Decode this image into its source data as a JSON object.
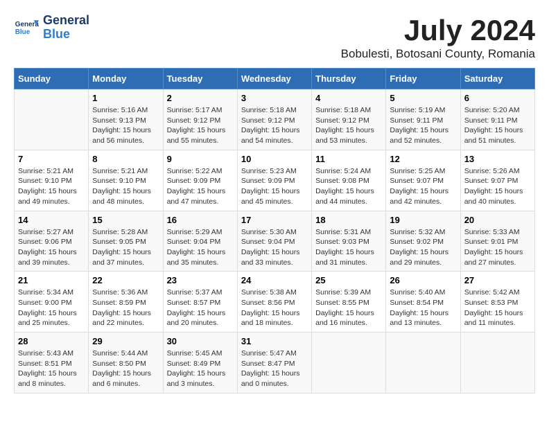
{
  "logo": {
    "name": "General",
    "name2": "Blue"
  },
  "title": "July 2024",
  "location": "Bobulesti, Botosani County, Romania",
  "days_of_week": [
    "Sunday",
    "Monday",
    "Tuesday",
    "Wednesday",
    "Thursday",
    "Friday",
    "Saturday"
  ],
  "weeks": [
    [
      {
        "day": "",
        "info": ""
      },
      {
        "day": "1",
        "info": "Sunrise: 5:16 AM\nSunset: 9:13 PM\nDaylight: 15 hours\nand 56 minutes."
      },
      {
        "day": "2",
        "info": "Sunrise: 5:17 AM\nSunset: 9:12 PM\nDaylight: 15 hours\nand 55 minutes."
      },
      {
        "day": "3",
        "info": "Sunrise: 5:18 AM\nSunset: 9:12 PM\nDaylight: 15 hours\nand 54 minutes."
      },
      {
        "day": "4",
        "info": "Sunrise: 5:18 AM\nSunset: 9:12 PM\nDaylight: 15 hours\nand 53 minutes."
      },
      {
        "day": "5",
        "info": "Sunrise: 5:19 AM\nSunset: 9:11 PM\nDaylight: 15 hours\nand 52 minutes."
      },
      {
        "day": "6",
        "info": "Sunrise: 5:20 AM\nSunset: 9:11 PM\nDaylight: 15 hours\nand 51 minutes."
      }
    ],
    [
      {
        "day": "7",
        "info": "Sunrise: 5:21 AM\nSunset: 9:10 PM\nDaylight: 15 hours\nand 49 minutes."
      },
      {
        "day": "8",
        "info": "Sunrise: 5:21 AM\nSunset: 9:10 PM\nDaylight: 15 hours\nand 48 minutes."
      },
      {
        "day": "9",
        "info": "Sunrise: 5:22 AM\nSunset: 9:09 PM\nDaylight: 15 hours\nand 47 minutes."
      },
      {
        "day": "10",
        "info": "Sunrise: 5:23 AM\nSunset: 9:09 PM\nDaylight: 15 hours\nand 45 minutes."
      },
      {
        "day": "11",
        "info": "Sunrise: 5:24 AM\nSunset: 9:08 PM\nDaylight: 15 hours\nand 44 minutes."
      },
      {
        "day": "12",
        "info": "Sunrise: 5:25 AM\nSunset: 9:07 PM\nDaylight: 15 hours\nand 42 minutes."
      },
      {
        "day": "13",
        "info": "Sunrise: 5:26 AM\nSunset: 9:07 PM\nDaylight: 15 hours\nand 40 minutes."
      }
    ],
    [
      {
        "day": "14",
        "info": "Sunrise: 5:27 AM\nSunset: 9:06 PM\nDaylight: 15 hours\nand 39 minutes."
      },
      {
        "day": "15",
        "info": "Sunrise: 5:28 AM\nSunset: 9:05 PM\nDaylight: 15 hours\nand 37 minutes."
      },
      {
        "day": "16",
        "info": "Sunrise: 5:29 AM\nSunset: 9:04 PM\nDaylight: 15 hours\nand 35 minutes."
      },
      {
        "day": "17",
        "info": "Sunrise: 5:30 AM\nSunset: 9:04 PM\nDaylight: 15 hours\nand 33 minutes."
      },
      {
        "day": "18",
        "info": "Sunrise: 5:31 AM\nSunset: 9:03 PM\nDaylight: 15 hours\nand 31 minutes."
      },
      {
        "day": "19",
        "info": "Sunrise: 5:32 AM\nSunset: 9:02 PM\nDaylight: 15 hours\nand 29 minutes."
      },
      {
        "day": "20",
        "info": "Sunrise: 5:33 AM\nSunset: 9:01 PM\nDaylight: 15 hours\nand 27 minutes."
      }
    ],
    [
      {
        "day": "21",
        "info": "Sunrise: 5:34 AM\nSunset: 9:00 PM\nDaylight: 15 hours\nand 25 minutes."
      },
      {
        "day": "22",
        "info": "Sunrise: 5:36 AM\nSunset: 8:59 PM\nDaylight: 15 hours\nand 22 minutes."
      },
      {
        "day": "23",
        "info": "Sunrise: 5:37 AM\nSunset: 8:57 PM\nDaylight: 15 hours\nand 20 minutes."
      },
      {
        "day": "24",
        "info": "Sunrise: 5:38 AM\nSunset: 8:56 PM\nDaylight: 15 hours\nand 18 minutes."
      },
      {
        "day": "25",
        "info": "Sunrise: 5:39 AM\nSunset: 8:55 PM\nDaylight: 15 hours\nand 16 minutes."
      },
      {
        "day": "26",
        "info": "Sunrise: 5:40 AM\nSunset: 8:54 PM\nDaylight: 15 hours\nand 13 minutes."
      },
      {
        "day": "27",
        "info": "Sunrise: 5:42 AM\nSunset: 8:53 PM\nDaylight: 15 hours\nand 11 minutes."
      }
    ],
    [
      {
        "day": "28",
        "info": "Sunrise: 5:43 AM\nSunset: 8:51 PM\nDaylight: 15 hours\nand 8 minutes."
      },
      {
        "day": "29",
        "info": "Sunrise: 5:44 AM\nSunset: 8:50 PM\nDaylight: 15 hours\nand 6 minutes."
      },
      {
        "day": "30",
        "info": "Sunrise: 5:45 AM\nSunset: 8:49 PM\nDaylight: 15 hours\nand 3 minutes."
      },
      {
        "day": "31",
        "info": "Sunrise: 5:47 AM\nSunset: 8:47 PM\nDaylight: 15 hours\nand 0 minutes."
      },
      {
        "day": "",
        "info": ""
      },
      {
        "day": "",
        "info": ""
      },
      {
        "day": "",
        "info": ""
      }
    ]
  ]
}
